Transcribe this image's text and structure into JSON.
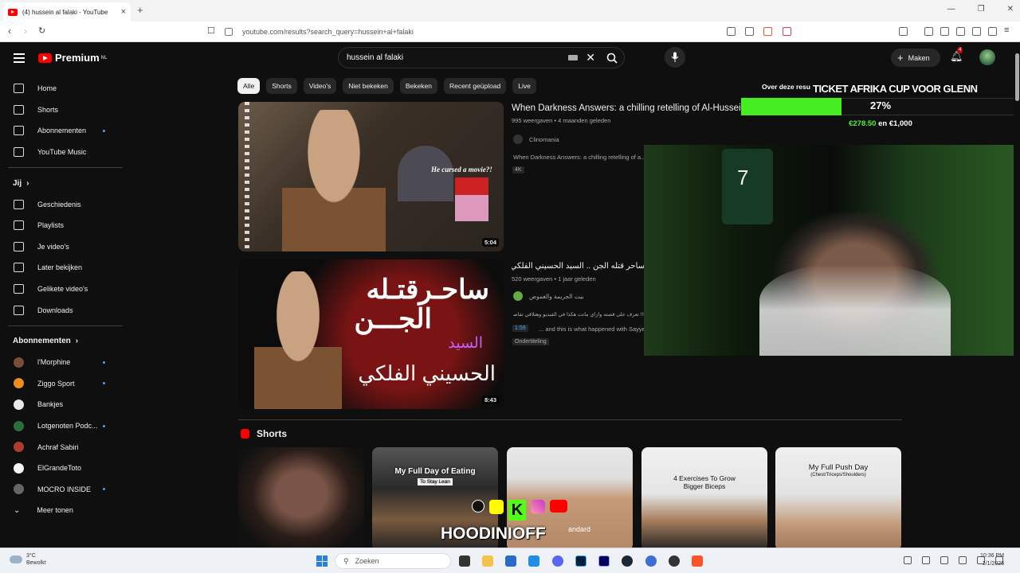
{
  "browser": {
    "tab_title": "(4) hussein al falaki - YouTube",
    "url": "youtube.com/results?search_query=hussein+al+falaki"
  },
  "header": {
    "logo": "Premium",
    "logo_region": "NL",
    "search_value": "hussein al falaki",
    "create_label": "Maken",
    "notifications": "4"
  },
  "sidebar": {
    "main": [
      {
        "label": "Home",
        "icon": "home-icon"
      },
      {
        "label": "Shorts",
        "icon": "shorts-icon"
      },
      {
        "label": "Abonnementen",
        "icon": "subscriptions-icon",
        "dot": true
      },
      {
        "label": "YouTube Music",
        "icon": "music-icon"
      }
    ],
    "you_header": "Jij",
    "you": [
      {
        "label": "Geschiedenis",
        "icon": "history-icon"
      },
      {
        "label": "Playlists",
        "icon": "playlists-icon"
      },
      {
        "label": "Je video's",
        "icon": "your-videos-icon"
      },
      {
        "label": "Later bekijken",
        "icon": "watch-later-icon"
      },
      {
        "label": "Gelikete video's",
        "icon": "liked-icon"
      },
      {
        "label": "Downloads",
        "icon": "download-icon"
      }
    ],
    "subs_header": "Abonnementen",
    "subs": [
      {
        "label": "l'Morphine",
        "color": "#7a4e3a",
        "dot": true
      },
      {
        "label": "Ziggo Sport",
        "color": "#f28c1e",
        "dot": true
      },
      {
        "label": "Bankjes",
        "color": "#e8e8e8",
        "dot": false
      },
      {
        "label": "Lotgenoten Podc...",
        "color": "#2a6e3a",
        "dot": true
      },
      {
        "label": "Achraf Sabiri",
        "color": "#b03a2e",
        "dot": false
      },
      {
        "label": "ElGrandeToto",
        "color": "#f5f5f5",
        "dot": false
      },
      {
        "label": "MOCRO INSIDE",
        "color": "#666666",
        "dot": true
      }
    ],
    "more": "Meer tonen"
  },
  "chips": [
    "Alle",
    "Shorts",
    "Video's",
    "Niet bekeken",
    "Bekeken",
    "Recent geüpload",
    "Live"
  ],
  "videos": [
    {
      "title": "When Darkness Answers: a chilling retelling of Al-Hussein",
      "meta": "995 weergaven • 4 maanden geleden",
      "channel": "Clinomania",
      "desc": "When Darkness Answers: a chilling retelling of a...",
      "badge": "4K",
      "duration": "5:04",
      "thumb_caption": "He cursed a movie?!"
    },
    {
      "title": "ساحر قتله الجن .. السيد الحسيني الفلكي وراء مـــوت !! علي ايد الجن",
      "meta": "520 weergaven • 1 jaar geleden",
      "channel": "بيت الجريمة والغموض",
      "desc_time": "1:59",
      "desc": "... and this is what happened with Sayye",
      "desc_arabic": "!!! تعرف على قصته وازاي ماتت هكذا في الفيديو وهتلاقي تفاصيل",
      "badge": "Ondertiteling",
      "duration": "8:43",
      "thumb_line1": "ساحـرقتـله",
      "thumb_line2": "الجـــن",
      "thumb_line3": "السيد",
      "thumb_line4": "الحسيني الفلكي"
    }
  ],
  "shorts_header": "Shorts",
  "shorts": [
    {
      "caption": ""
    },
    {
      "caption": "My Full Day of Eating",
      "sub": "To Stay Lean"
    },
    {
      "caption": ""
    },
    {
      "caption": "4 Exercises To Grow Bigger Biceps"
    },
    {
      "caption": "My Full Push Day",
      "sub": "(Chest/Triceps/Shoulders)"
    }
  ],
  "overlay": {
    "about_text": "Over deze resu",
    "donation_title": "TICKET AFRIKA CUP VOOR GLENN",
    "progress": 0.27,
    "percent": "27%",
    "raised": "€278.50",
    "of_text": "en €1,000",
    "streamer_tag": "HOODINIOFF",
    "streamer_suffix": "andard"
  },
  "taskbar": {
    "temp": "3°C",
    "weather": "Bewolkt",
    "search": "Zoeken",
    "time": "10:36 PM",
    "date": "1/1/2026"
  }
}
